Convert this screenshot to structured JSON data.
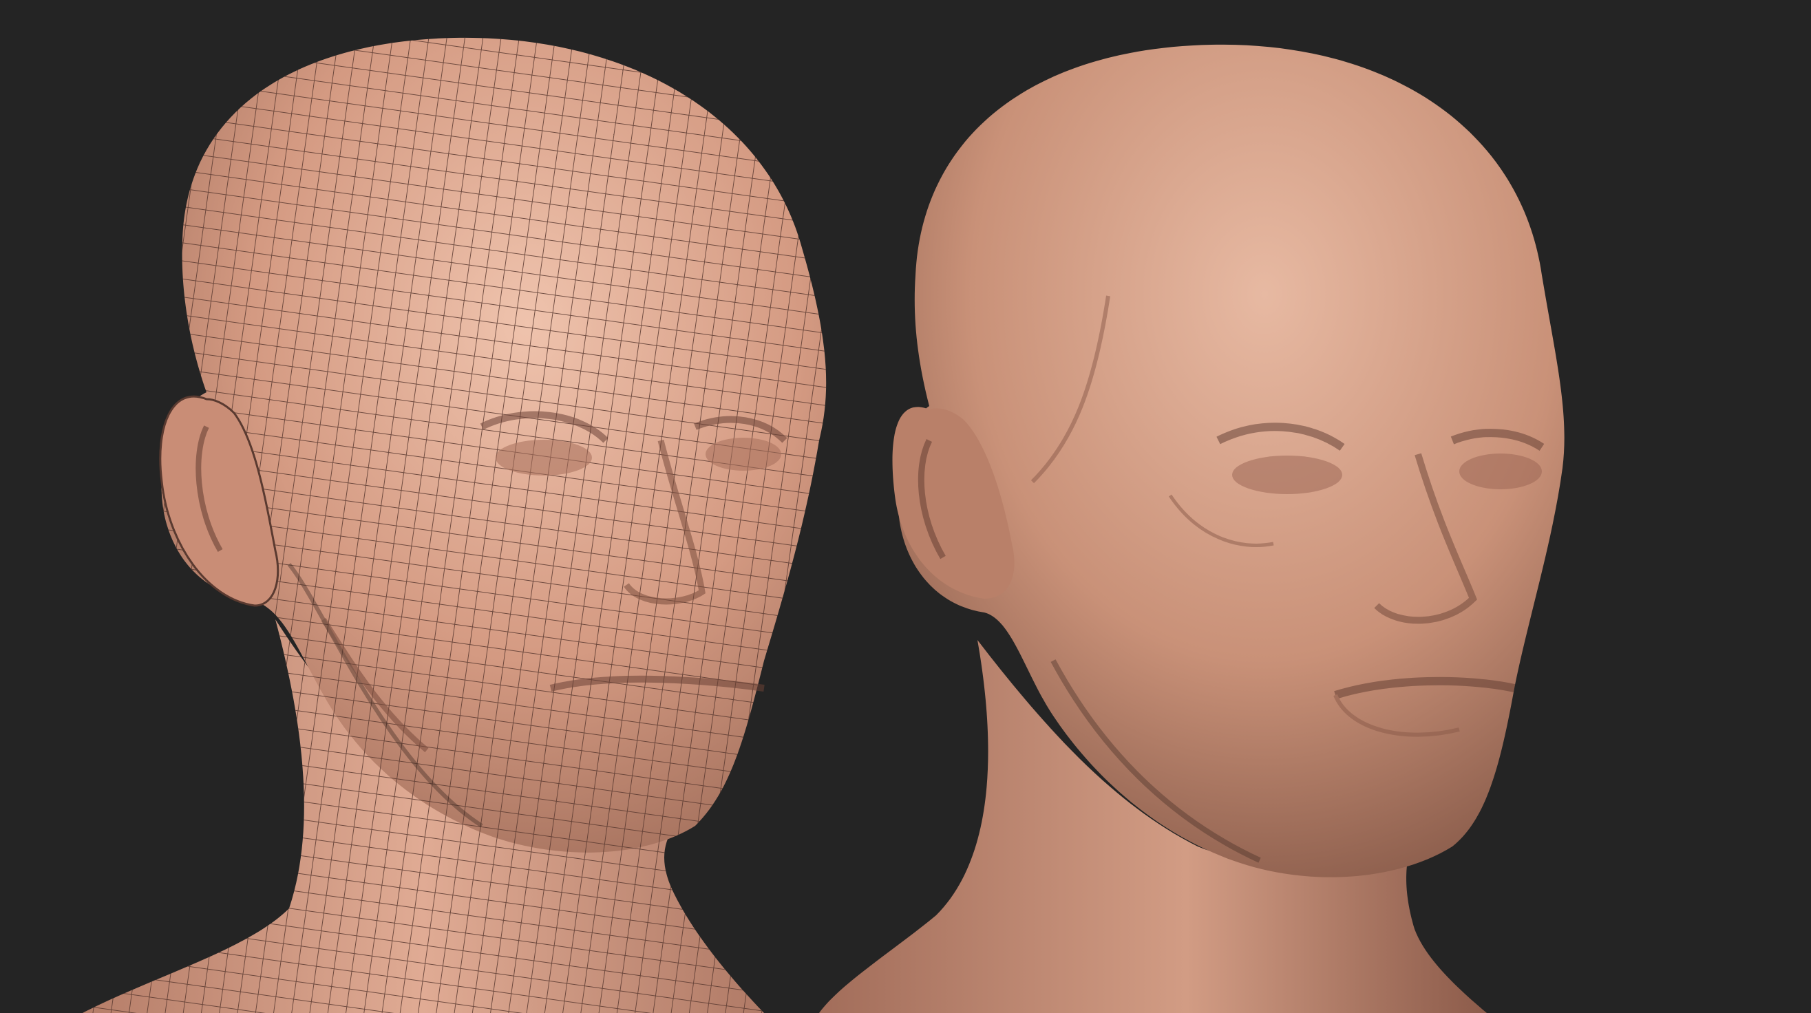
{
  "scene": {
    "background_color": "#242424",
    "models": [
      {
        "name": "wireframe-head",
        "skin_color": "#d49a82",
        "shade_color": "#9c6a57",
        "highlight_color": "#efc3ad",
        "wire_color": "#5a3a30"
      },
      {
        "name": "sculpted-head",
        "skin_color": "#c99178",
        "shade_color": "#8e5d4c",
        "highlight_color": "#e7b9a2"
      }
    ]
  }
}
